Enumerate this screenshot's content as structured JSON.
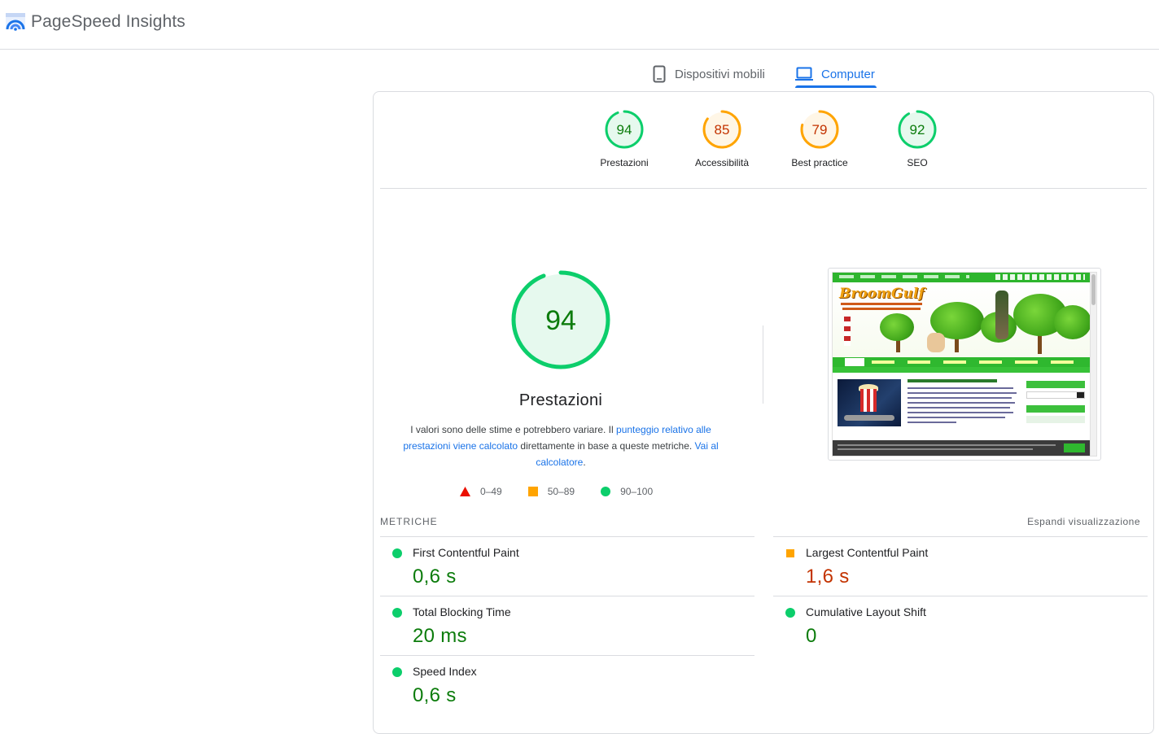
{
  "app": {
    "title": "PageSpeed Insights"
  },
  "tabs": [
    {
      "label": "Dispositivi mobili",
      "icon": "smartphone-icon",
      "selected": false
    },
    {
      "label": "Computer",
      "icon": "laptop-icon",
      "selected": true
    }
  ],
  "colors": {
    "good": "#0cce6b",
    "average": "#ffa400",
    "poor": "#ff4e42",
    "accent": "#1a73e8"
  },
  "scores": [
    {
      "label": "Prestazioni",
      "value": "94",
      "rating": "good"
    },
    {
      "label": "Accessibilità",
      "value": "85",
      "rating": "average"
    },
    {
      "label": "Best practice",
      "value": "79",
      "rating": "average"
    },
    {
      "label": "SEO",
      "value": "92",
      "rating": "good"
    }
  ],
  "performance": {
    "score": "94",
    "title": "Prestazioni",
    "desc_1": "I valori sono delle stime e potrebbero variare. Il ",
    "link_1": "punteggio relativo alle prestazioni viene calcolato",
    "desc_2": " direttamente in base a queste metriche. ",
    "link_2": "Vai al calcolatore",
    "desc_3": "."
  },
  "legend": [
    {
      "range": "0–49",
      "icon": "triangle-red-icon"
    },
    {
      "range": "50–89",
      "icon": "square-orange-icon"
    },
    {
      "range": "90–100",
      "icon": "circle-green-icon"
    }
  ],
  "screenshot": {
    "brand": "BroomGulf"
  },
  "metrics": {
    "title": "METRICHE",
    "expand_label": "Espandi visualizzazione",
    "items": [
      {
        "name": "First Contentful Paint",
        "value": "0,6 s",
        "rating": "good"
      },
      {
        "name": "Largest Contentful Paint",
        "value": "1,6 s",
        "rating": "average"
      },
      {
        "name": "Total Blocking Time",
        "value": "20 ms",
        "rating": "good"
      },
      {
        "name": "Cumulative Layout Shift",
        "value": "0",
        "rating": "good"
      },
      {
        "name": "Speed Index",
        "value": "0,6 s",
        "rating": "good"
      }
    ]
  }
}
